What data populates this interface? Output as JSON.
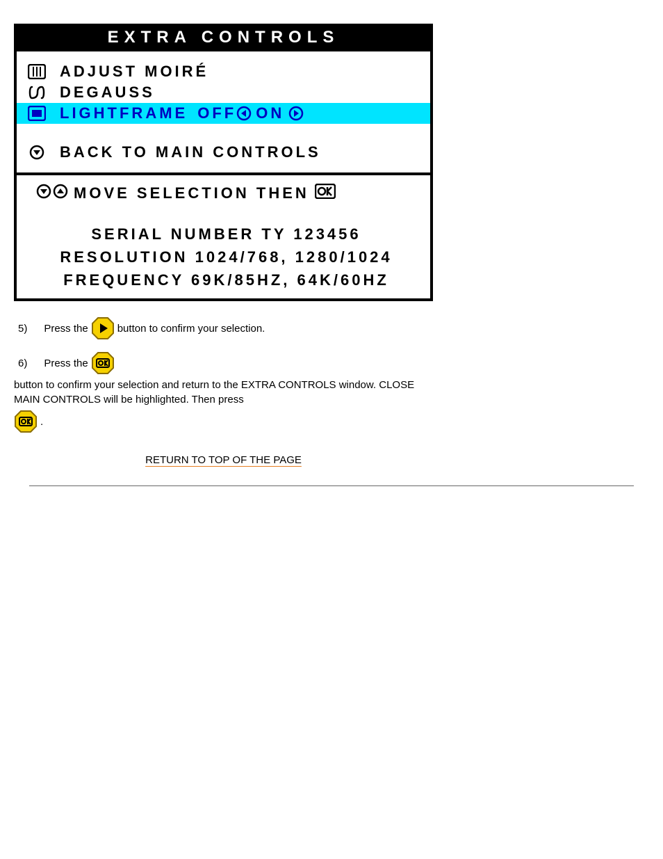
{
  "osd": {
    "title": "EXTRA CONTROLS",
    "items": [
      {
        "label": "ADJUST MOIRÉ"
      },
      {
        "label": "DEGAUSS"
      }
    ],
    "highlight": {
      "label": "LIGHTFRAME",
      "off": "OFF",
      "on": "ON"
    },
    "back": "BACK TO MAIN CONTROLS",
    "hint_pre": "MOVE SELECTION THEN",
    "serial": "SERIAL NUMBER TY 123456",
    "resolution": "RESOLUTION 1024/768, 1280/1024",
    "frequency": "FREQUENCY 69K/85HZ, 64K/60HZ"
  },
  "instructions": {
    "step5_num": "5)",
    "step5_pre": "Press the",
    "step5_post": "button to confirm your selection.",
    "step6_num": "6)",
    "step6_pre": "Press the",
    "step6_mid": "button to confirm your selection and return to the EXTRA CONTROLS window. CLOSE MAIN CONTROLS will be highlighted. Then press",
    "step6_post": "."
  },
  "return_link": "RETURN TO TOP OF THE PAGE"
}
